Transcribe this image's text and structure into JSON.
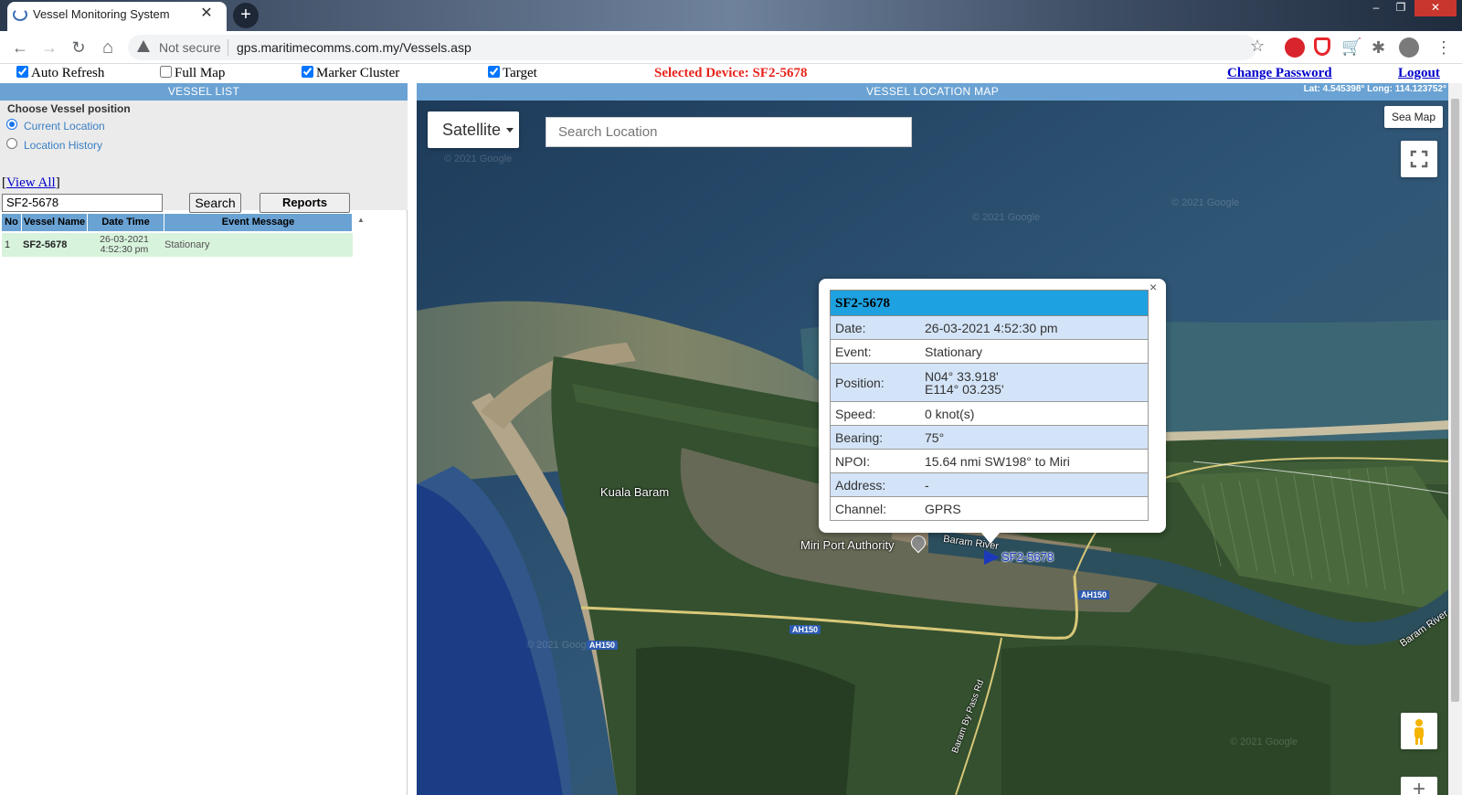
{
  "browser": {
    "tab_title": "Vessel Monitoring System",
    "tab_close": "✕",
    "new_tab": "+",
    "win_min": "–",
    "win_max": "❐",
    "win_close": "✕",
    "back": "←",
    "forward": "→",
    "reload": "↻",
    "home": "⌂",
    "security_label": "Not secure",
    "url": "gps.maritimecomms.com.my/Vessels.asp",
    "star": "☆",
    "extensions": [
      {
        "name": "adblock-icon",
        "color": "#d9232d"
      },
      {
        "name": "shield-icon",
        "color": "#e8262c"
      },
      {
        "name": "cart-icon",
        "color": "#d91e25"
      },
      {
        "name": "puzzle-icon",
        "color": "#6e6e6e"
      },
      {
        "name": "profile-icon",
        "color": "#7a7a7a"
      }
    ],
    "menu": "⋮"
  },
  "options": {
    "auto_refresh": {
      "label": "Auto Refresh",
      "checked": true
    },
    "full_map": {
      "label": "Full Map",
      "checked": false
    },
    "marker_cluster": {
      "label": "Marker Cluster",
      "checked": true
    },
    "target": {
      "label": "Target",
      "checked": true
    }
  },
  "selected_device": "Selected Device: SF2-5678",
  "links": {
    "change_password": "Change Password",
    "logout": "Logout"
  },
  "vessel_list": {
    "header": "VESSEL LIST",
    "choose_label": "Choose Vessel position",
    "radio_current": "Current Location",
    "radio_history": "Location History",
    "view_all_open": "[",
    "view_all": "View All",
    "view_all_close": "]",
    "search_value": "SF2-5678",
    "search_button": "Search",
    "reports_button": "Reports",
    "columns": [
      "No",
      "Vessel Name",
      "Date Time",
      "Event Message"
    ],
    "rows": [
      {
        "no": "1",
        "name": "SF2-5678",
        "date": "26-03-2021",
        "time": "4:52:30 pm",
        "event": "Stationary"
      }
    ]
  },
  "map": {
    "header": "VESSEL LOCATION MAP",
    "latlong": "Lat: 4.545398° Long: 114.123752°",
    "map_type": "Satellite",
    "search_placeholder": "Search Location",
    "sea_map_button": "Sea Map",
    "zoom_in": "+",
    "labels": {
      "kuala_baram": "Kuala Baram",
      "miri_port": "Miri Port Authority",
      "baram_river_1": "Baram River",
      "baram_river_2": "Baram River",
      "bypass": "Baram By Pass Rd",
      "ah150_a": "AH150",
      "ah150_b": "AH150",
      "ah150_c": "AH150"
    },
    "watermark": "© 2021 Google",
    "marker_label": "SF2-5678"
  },
  "info_window": {
    "title": "SF2-5678",
    "close": "×",
    "rows": [
      {
        "label": "Date:",
        "value": "26-03-2021 4:52:30 pm"
      },
      {
        "label": "Event:",
        "value": "Stationary"
      },
      {
        "label": "Position:",
        "value": "N04° 33.918'",
        "value2": "E114° 03.235'"
      },
      {
        "label": "Speed:",
        "value": "0 knot(s)"
      },
      {
        "label": "Bearing:",
        "value": "75°"
      },
      {
        "label": "NPOI:",
        "value": "15.64 nmi SW198° to Miri"
      },
      {
        "label": "Address:",
        "value": "-"
      },
      {
        "label": "Channel:",
        "value": "GPRS"
      }
    ]
  }
}
